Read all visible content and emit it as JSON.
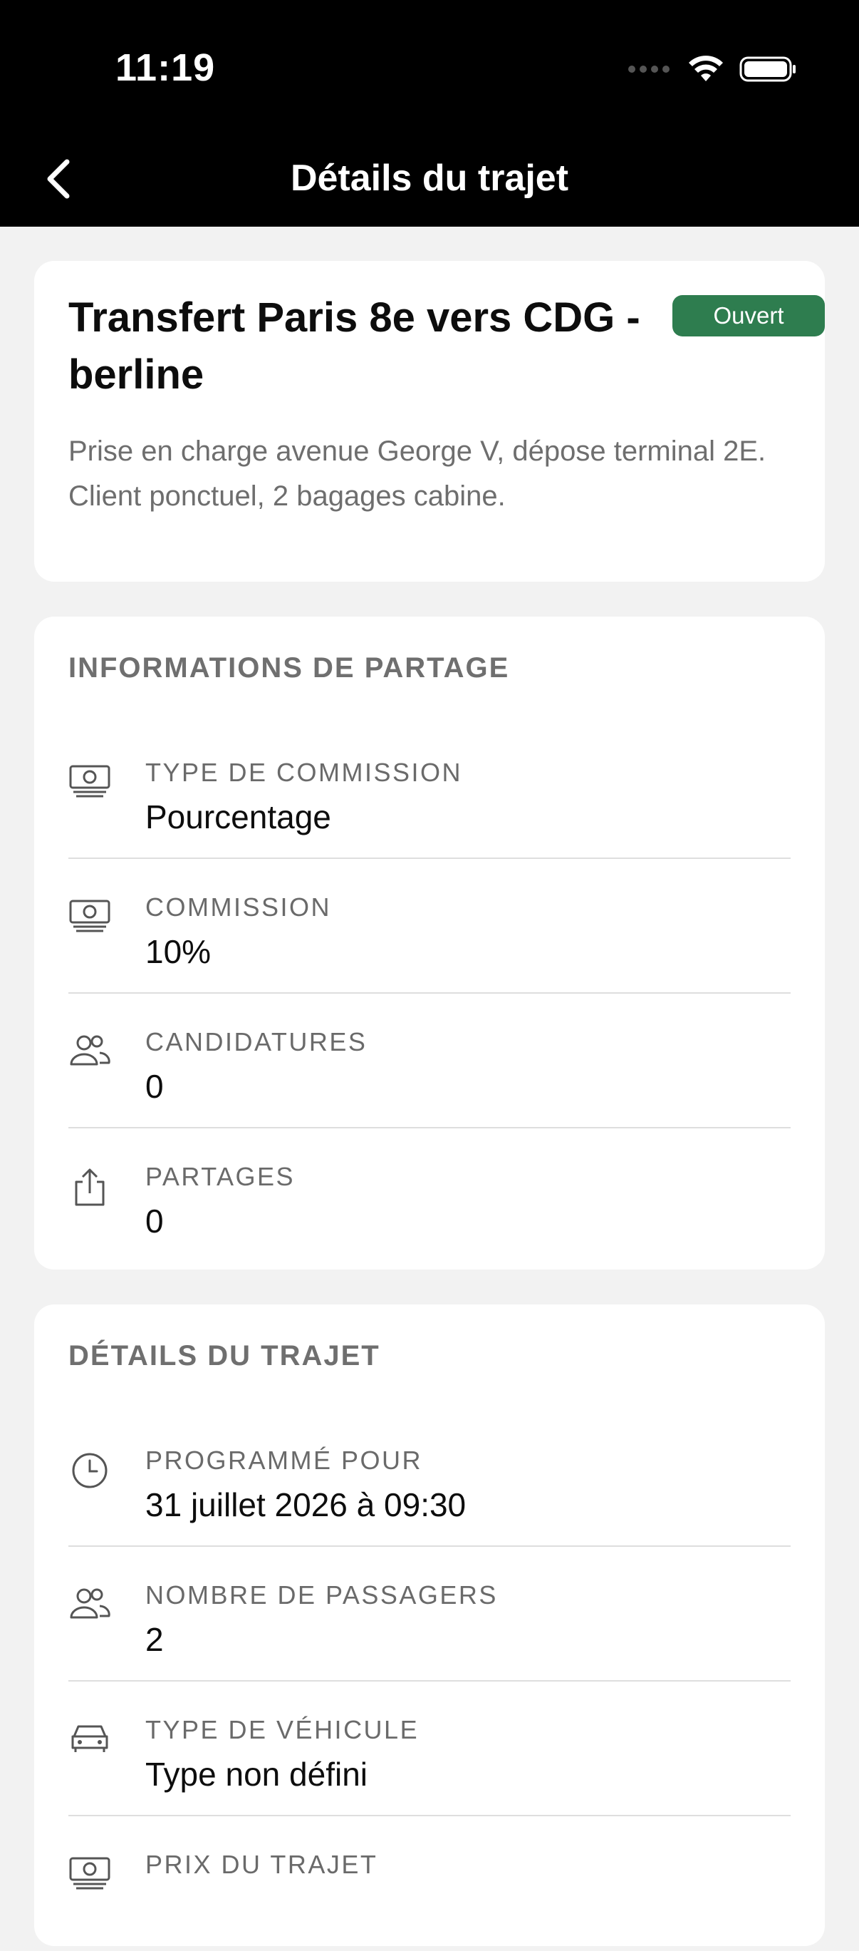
{
  "status_bar": {
    "time": "11:19"
  },
  "nav": {
    "title": "Détails du trajet"
  },
  "hero": {
    "title": "Transfert Paris 8e vers CDG - berline",
    "badge": "Ouvert",
    "description": "Prise en charge avenue George V, dépose terminal 2E. Client ponctuel, 2 bagages cabine."
  },
  "share_section": {
    "title": "INFORMATIONS DE PARTAGE",
    "rows": [
      {
        "icon": "money-icon",
        "label": "TYPE DE COMMISSION",
        "value": "Pourcentage"
      },
      {
        "icon": "money-icon",
        "label": "COMMISSION",
        "value": "10%"
      },
      {
        "icon": "people-icon",
        "label": "CANDIDATURES",
        "value": "0"
      },
      {
        "icon": "share-icon",
        "label": "PARTAGES",
        "value": "0"
      }
    ]
  },
  "trip_section": {
    "title": "DÉTAILS DU TRAJET",
    "rows": [
      {
        "icon": "clock-icon",
        "label": "PROGRAMMÉ POUR",
        "value": "31 juillet 2026 à 09:30"
      },
      {
        "icon": "people-icon",
        "label": "NOMBRE DE PASSAGERS",
        "value": "2"
      },
      {
        "icon": "car-icon",
        "label": "TYPE DE VÉHICULE",
        "value": "Type non défini"
      },
      {
        "icon": "money-icon",
        "label": "PRIX DU TRAJET",
        "value": ""
      }
    ]
  },
  "colors": {
    "badge_green": "#2e7d4f",
    "header_bg": "#000000",
    "page_bg": "#f2f2f2"
  }
}
